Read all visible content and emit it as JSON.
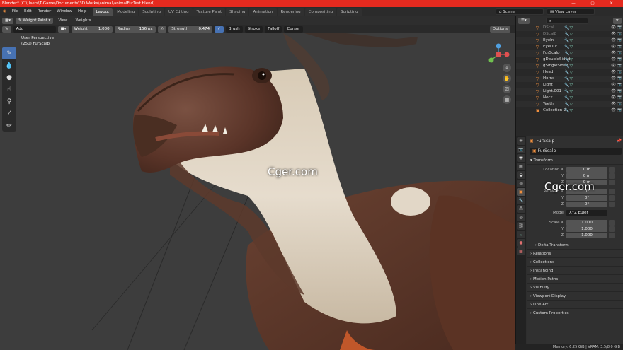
{
  "window": {
    "title": "Blender* [C:\\Users\\T-Game\\Documents\\3D Works\\animal\\animalFurTest.blend]",
    "controls": "— ▢ ✕"
  },
  "menu": [
    "File",
    "Edit",
    "Render",
    "Window",
    "Help"
  ],
  "workspaces": [
    {
      "label": "Layout",
      "active": true
    },
    {
      "label": "Modeling",
      "active": false
    },
    {
      "label": "Sculpting",
      "active": false
    },
    {
      "label": "UV Editing",
      "active": false
    },
    {
      "label": "Texture Paint",
      "active": false
    },
    {
      "label": "Shading",
      "active": false
    },
    {
      "label": "Animation",
      "active": false
    },
    {
      "label": "Rendering",
      "active": false
    },
    {
      "label": "Compositing",
      "active": false
    },
    {
      "label": "Scripting",
      "active": false
    }
  ],
  "scene": {
    "name": "Scene",
    "view_layer": "View Layer"
  },
  "tool_header": {
    "mode": "Weight Paint",
    "view": "View",
    "weights": "Weights",
    "blend": "Add",
    "weight_label": "Weight",
    "weight_value": "1.000",
    "radius_label": "Radius",
    "radius_value": "156 px",
    "strength_label": "Strength",
    "strength_value": "0.474",
    "brush": "Brush",
    "stroke": "Stroke",
    "falloff": "Falloff",
    "cursor": "Cursor",
    "options": "Options"
  },
  "viewport": {
    "perspective": "User Perspective",
    "object_info": "(250) FurScalp",
    "watermark": "Cger.com"
  },
  "outliner": {
    "search_placeholder": "",
    "rows": [
      {
        "name": "DScal",
        "dim": true
      },
      {
        "name": "DScal8",
        "dim": true
      },
      {
        "name": "EyeIn",
        "dim": false
      },
      {
        "name": "EyeOut",
        "dim": false
      },
      {
        "name": "FurScalp",
        "dim": false
      },
      {
        "name": "gDoubleSided",
        "dim": false
      },
      {
        "name": "gSingleSided",
        "dim": false
      },
      {
        "name": "Head",
        "dim": false
      },
      {
        "name": "Horns",
        "dim": false
      },
      {
        "name": "Light",
        "dim": false
      },
      {
        "name": "Light.001",
        "dim": false
      },
      {
        "name": "Neck",
        "dim": false
      },
      {
        "name": "Teeth",
        "dim": false
      },
      {
        "name": "Collection 2",
        "dim": false
      }
    ]
  },
  "properties": {
    "object_name": "FurScalp",
    "object_field": "FurScalp",
    "transform": "Transform",
    "location": {
      "label": "Location X",
      "x": "0 m",
      "y": "0 m",
      "z": "0 m"
    },
    "rotation": {
      "label": "Rotation X",
      "x": "0°",
      "y": "0°",
      "z": "0°"
    },
    "mode_label": "Mode",
    "mode_value": "XYZ Euler",
    "scale": {
      "label": "Scale X",
      "x": "1.000",
      "y": "1.000",
      "z": "1.000"
    },
    "axis_y": "Y",
    "axis_z": "Z",
    "delta": "Delta Transform",
    "sections": [
      "Relations",
      "Collections",
      "Instancing",
      "Motion Paths",
      "Visibility",
      "Viewport Display",
      "Line Art",
      "Custom Properties"
    ]
  },
  "status": "Memory: 6.25 GiB | VRAM: 3.5/8.0 GiB",
  "colors": {
    "title_bar": "#e52a1f",
    "accent": "#4772b3",
    "object_icon": "#f08f3e",
    "modifier_icon": "#7ec3ad"
  }
}
